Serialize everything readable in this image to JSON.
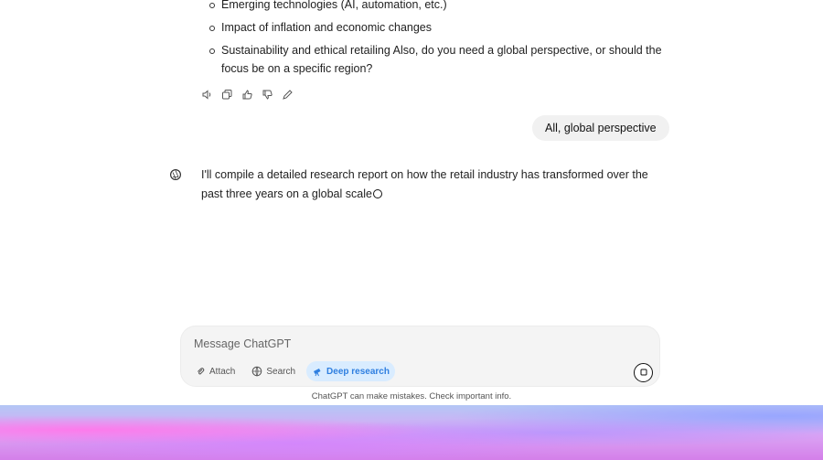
{
  "conversation": {
    "bullets": [
      {
        "text": "Emerging technologies (AI, automation, etc.)"
      },
      {
        "text": "Impact of inflation and economic changes"
      },
      {
        "text": "Sustainability and ethical retailing Also, do you need a global perspective, or should the focus be on a specific region?"
      }
    ],
    "user_message": "All, global perspective",
    "assistant_reply": "I'll compile a detailed research report on how the retail industry has transformed over the past three years on a global scale"
  },
  "message_actions": [
    {
      "icon": "speaker-icon"
    },
    {
      "icon": "copy-icon"
    },
    {
      "icon": "thumbs-up-icon"
    },
    {
      "icon": "thumbs-down-icon"
    },
    {
      "icon": "edit-icon"
    }
  ],
  "composer": {
    "placeholder": "Message ChatGPT",
    "tools": [
      {
        "label": "Attach",
        "icon": "paperclip-icon"
      },
      {
        "label": "Search",
        "icon": "globe-icon"
      },
      {
        "label": "Deep research",
        "icon": "telescope-icon",
        "active": true
      }
    ],
    "send_icon": "stop-icon"
  },
  "footer": {
    "disclaimer": "ChatGPT can make mistakes. Check important info."
  },
  "theme": {
    "active_tool_bg": "#d9ecff",
    "active_tool_text": "#2f7fe0",
    "bubble_bg": "#f1f1f1"
  }
}
